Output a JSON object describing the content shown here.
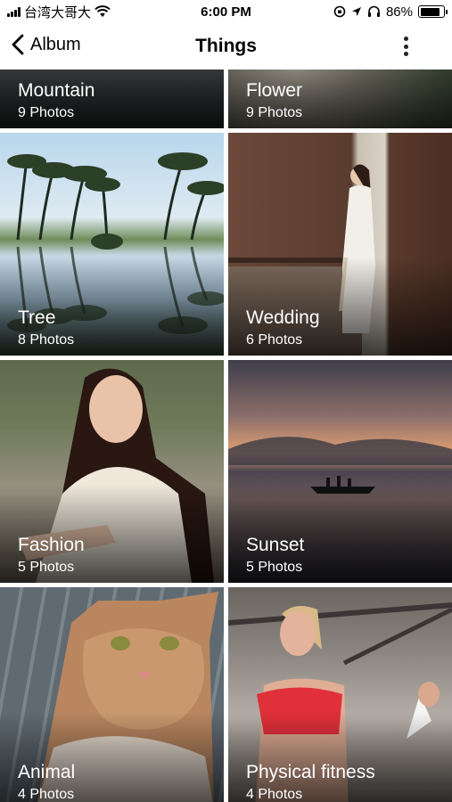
{
  "status_bar": {
    "carrier": "台湾大哥大",
    "time": "6:00 PM",
    "battery": "86%",
    "battery_level": 0.86
  },
  "nav": {
    "back_label": "Album",
    "title": "Things",
    "more_icon": "more-vertical-icon"
  },
  "albums": [
    {
      "name": "Mountain",
      "count": "9 Photos"
    },
    {
      "name": "Flower",
      "count": "9 Photos"
    },
    {
      "name": "Tree",
      "count": "8 Photos"
    },
    {
      "name": "Wedding",
      "count": "6 Photos"
    },
    {
      "name": "Fashion",
      "count": "5 Photos"
    },
    {
      "name": "Sunset",
      "count": "5 Photos"
    },
    {
      "name": "Animal",
      "count": "4 Photos"
    },
    {
      "name": "Physical fitness",
      "count": "4 Photos"
    }
  ]
}
